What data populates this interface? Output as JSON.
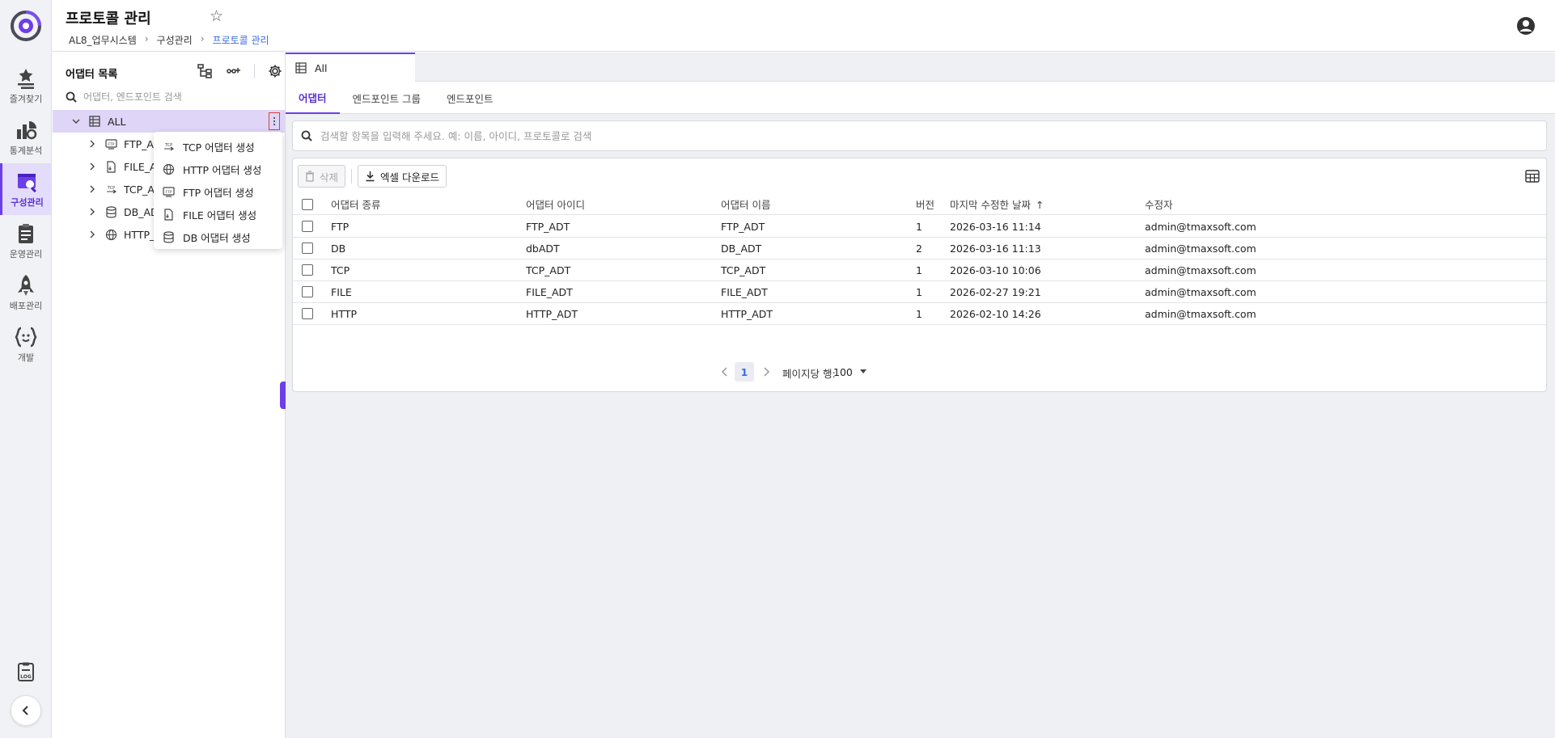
{
  "rail": {
    "items": [
      {
        "label": "즐겨찾기",
        "icon": "star-list-icon"
      },
      {
        "label": "통계분석",
        "icon": "chart-icon"
      },
      {
        "label": "구성관리",
        "icon": "config-icon"
      },
      {
        "label": "운영관리",
        "icon": "clipboard-icon"
      },
      {
        "label": "배포관리",
        "icon": "rocket-icon"
      },
      {
        "label": "개발",
        "icon": "code-braces-icon"
      }
    ],
    "active_index": 2,
    "accent": "#6c3fe8"
  },
  "header": {
    "title": "프로토콜 관리",
    "breadcrumb": [
      "AL8_업무시스템",
      "구성관리",
      "프로토콜 관리"
    ]
  },
  "tree": {
    "title": "어댑터 목록",
    "search_placeholder": "어댑터, 엔드포인트 검색",
    "root": "ALL",
    "children": [
      {
        "label": "FTP_AI",
        "icon": "ftp-icon"
      },
      {
        "label": "FILE_A",
        "icon": "file-icon"
      },
      {
        "label": "TCP_Al",
        "icon": "tcp-icon"
      },
      {
        "label": "DB_AD",
        "icon": "database-icon"
      },
      {
        "label": "HTTP_",
        "icon": "globe-icon"
      }
    ]
  },
  "context_menu": {
    "items": [
      {
        "label": "TCP 어댑터 생성",
        "icon": "tcp-icon"
      },
      {
        "label": "HTTP 어댑터 생성",
        "icon": "globe-icon"
      },
      {
        "label": "FTP 어댑터 생성",
        "icon": "ftp-icon"
      },
      {
        "label": "FILE 어댑터 생성",
        "icon": "file-icon"
      },
      {
        "label": "DB 어댑터 생성",
        "icon": "database-icon"
      }
    ]
  },
  "main": {
    "tab": "All",
    "subtabs": [
      "어댑터",
      "엔드포인트 그룹",
      "엔드포인트"
    ],
    "active_subtab": 0,
    "search_placeholder": "검색할 항목을 입력해 주세요. 예: 이름, 아이디, 프로토콜로 검색",
    "delete_label": "삭제",
    "excel_label": "엑셀 다운로드",
    "columns": [
      "어댑터 종류",
      "어댑터 아이디",
      "어댑터 이름",
      "버전",
      "마지막 수정한 날짜",
      "수정자"
    ],
    "rows": [
      [
        "FTP",
        "FTP_ADT",
        "FTP_ADT",
        "1",
        "2026-03-16 11:14",
        "admin@tmaxsoft.com"
      ],
      [
        "DB",
        "dbADT",
        "DB_ADT",
        "2",
        "2026-03-16 11:13",
        "admin@tmaxsoft.com"
      ],
      [
        "TCP",
        "TCP_ADT",
        "TCP_ADT",
        "1",
        "2026-03-10 10:06",
        "admin@tmaxsoft.com"
      ],
      [
        "FILE",
        "FILE_ADT",
        "FILE_ADT",
        "1",
        "2026-02-27 19:21",
        "admin@tmaxsoft.com"
      ],
      [
        "HTTP",
        "HTTP_ADT",
        "HTTP_ADT",
        "1",
        "2026-02-10 14:26",
        "admin@tmaxsoft.com"
      ]
    ],
    "pagination": {
      "page": "1",
      "rows_label": "페이지당 행:",
      "page_size": "100"
    }
  }
}
